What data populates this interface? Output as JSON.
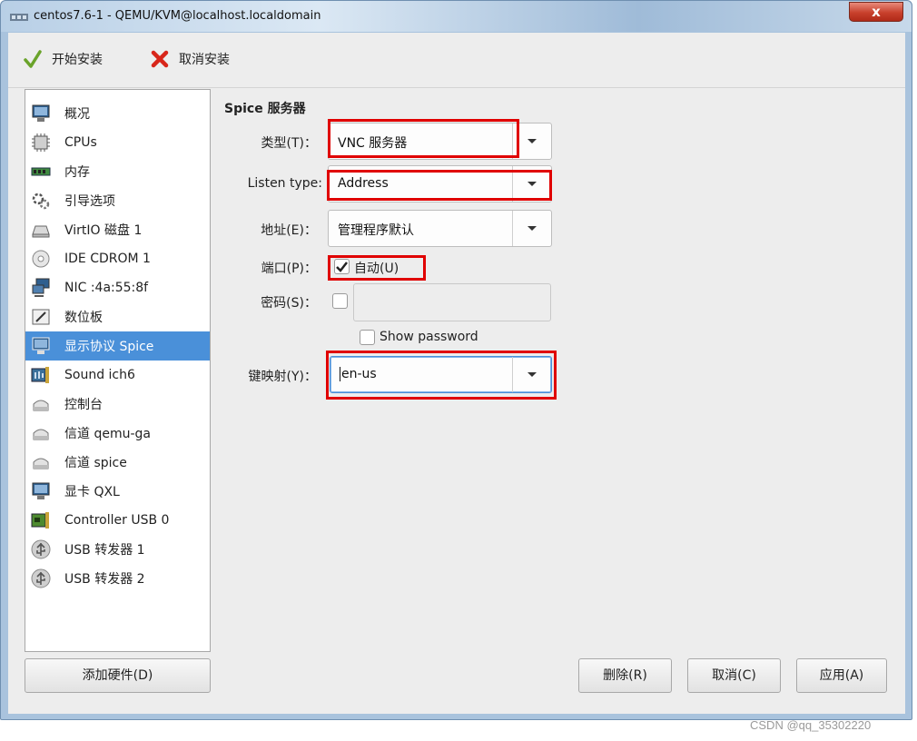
{
  "window": {
    "title": "centos7.6-1 - QEMU/KVM@localhost.localdomain",
    "close_label": "x"
  },
  "toolbar": {
    "start_install": "开始安装",
    "cancel_install": "取消安装"
  },
  "sidebar": {
    "items": [
      {
        "label": "概况",
        "icon": "overview-monitor-icon"
      },
      {
        "label": "CPUs",
        "icon": "cpu-icon"
      },
      {
        "label": "内存",
        "icon": "memory-icon"
      },
      {
        "label": "引导选项",
        "icon": "boot-options-gear-icon"
      },
      {
        "label": "VirtIO 磁盘 1",
        "icon": "disk-icon"
      },
      {
        "label": "IDE CDROM 1",
        "icon": "cdrom-icon"
      },
      {
        "label": "NIC :4a:55:8f",
        "icon": "network-icon"
      },
      {
        "label": "数位板",
        "icon": "tablet-icon"
      },
      {
        "label": "显示协议 Spice",
        "icon": "display-monitor-icon",
        "selected": true
      },
      {
        "label": "Sound ich6",
        "icon": "sound-card-icon"
      },
      {
        "label": "控制台",
        "icon": "console-icon"
      },
      {
        "label": "信道 qemu-ga",
        "icon": "channel-icon"
      },
      {
        "label": "信道 spice",
        "icon": "channel-icon"
      },
      {
        "label": "显卡 QXL",
        "icon": "video-card-icon"
      },
      {
        "label": "Controller USB 0",
        "icon": "controller-card-icon"
      },
      {
        "label": "USB 转发器 1",
        "icon": "usb-icon"
      },
      {
        "label": "USB 转发器 2",
        "icon": "usb-icon"
      }
    ],
    "add_hardware": "添加硬件(D)"
  },
  "details": {
    "section_title": "Spice 服务器",
    "type_label": "类型(T)：",
    "type_value": "VNC 服务器",
    "listen_label": "Listen type:",
    "listen_value": "Address",
    "address_label": "地址(E)：",
    "address_value": "管理程序默认",
    "port_label": "端口(P)：",
    "port_auto_label": "自动(U)",
    "port_auto_checked": true,
    "password_label": "密码(S)：",
    "password_checked": false,
    "show_password_label": "Show password",
    "keymap_label": "键映射(Y)：",
    "keymap_value": "en-us"
  },
  "buttons": {
    "remove": "删除(R)",
    "cancel": "取消(C)",
    "apply": "应用(A)"
  },
  "watermark": "CSDN @qq_35302220",
  "colors": {
    "selection": "#4a90d9",
    "highlight": "#e00000"
  }
}
